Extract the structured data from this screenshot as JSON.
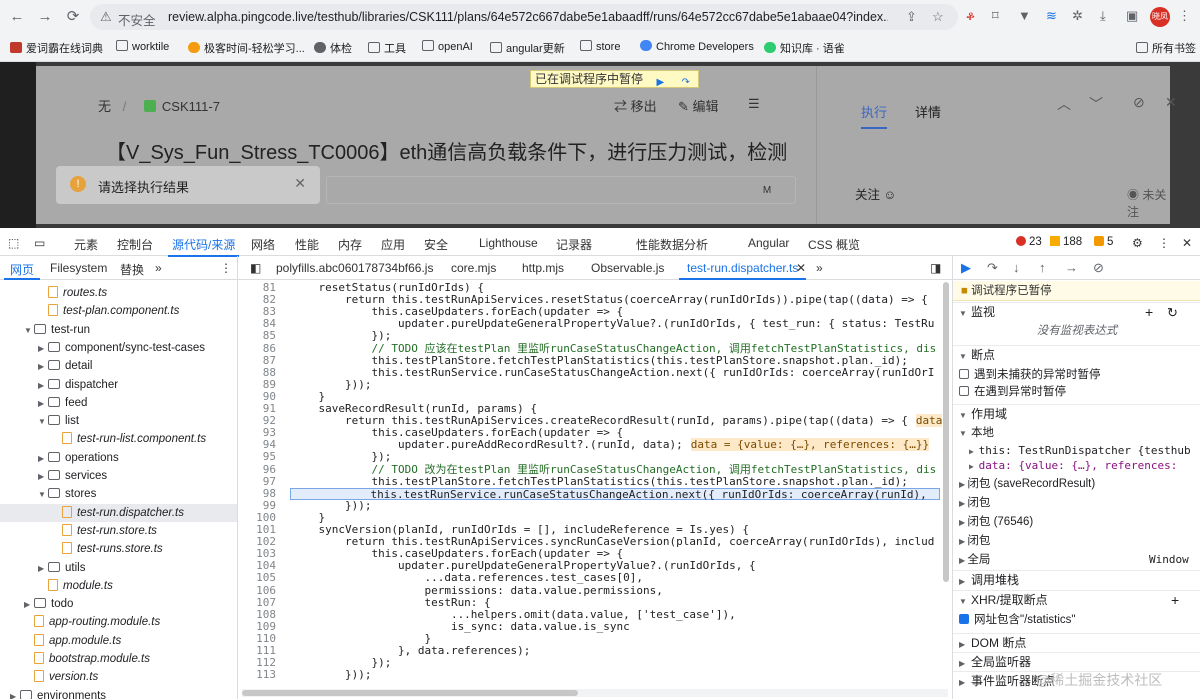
{
  "browser": {
    "not_secure": "不安全",
    "url": "review.alpha.pingcode.live/testhub/libraries/CSK111/plans/64e572c667dabe5e1abaadff/runs/64e572cc67dabe5e1abaae04?index...",
    "avatar_text": "晓凤",
    "bookmarks": [
      "爱词霸在线词典",
      "worktile",
      "极客时间-轻松学习...",
      "体检",
      "工具",
      "openAI",
      "angular更新",
      "store",
      "Chrome Developers",
      "知识库 · 语雀"
    ],
    "all_bookmarks": "所有书签"
  },
  "page": {
    "paused_banner": "已在调试程序中暂停",
    "breadcrumb_none": "无",
    "breadcrumb_sep": "/",
    "breadcrumb_case": "CSK111-7",
    "move_out": "移出",
    "edit": "编辑",
    "title": "【V_Sys_Fun_Stress_TC0006】eth通信高负载条件下，进行压力测试，检测",
    "toast": "请选择执行结果",
    "member_initial": "M",
    "tab_execute": "执行",
    "tab_detail": "详情",
    "follow": "关注",
    "not_follow": "未关注"
  },
  "devtools": {
    "tabs": [
      "元素",
      "控制台",
      "源代码/来源",
      "网络",
      "性能",
      "内存",
      "应用",
      "安全",
      "Lighthouse",
      "记录器",
      "性能数据分析",
      "Angular",
      "CSS 概览"
    ],
    "active_tab": "源代码/来源",
    "errors": "23",
    "warnings": "188",
    "issues": "5",
    "nav_tabs": [
      "网页",
      "Filesystem",
      "替换"
    ],
    "tree": [
      {
        "label": "routes.ts",
        "type": "file",
        "indent": 3,
        "italic": true
      },
      {
        "label": "test-plan.component.ts",
        "type": "file",
        "indent": 3,
        "italic": true
      },
      {
        "label": "test-run",
        "type": "folder",
        "indent": 2,
        "open": true
      },
      {
        "label": "component/sync-test-cases",
        "type": "folder",
        "indent": 3
      },
      {
        "label": "detail",
        "type": "folder",
        "indent": 3
      },
      {
        "label": "dispatcher",
        "type": "folder",
        "indent": 3
      },
      {
        "label": "feed",
        "type": "folder",
        "indent": 3
      },
      {
        "label": "list",
        "type": "folder",
        "indent": 3,
        "open": true
      },
      {
        "label": "test-run-list.component.ts",
        "type": "file",
        "indent": 4,
        "italic": true
      },
      {
        "label": "operations",
        "type": "folder",
        "indent": 3
      },
      {
        "label": "services",
        "type": "folder",
        "indent": 3
      },
      {
        "label": "stores",
        "type": "folder",
        "indent": 3,
        "open": true
      },
      {
        "label": "test-run.dispatcher.ts",
        "type": "file",
        "indent": 4,
        "italic": true,
        "selected": true
      },
      {
        "label": "test-run.store.ts",
        "type": "file",
        "indent": 4,
        "italic": true
      },
      {
        "label": "test-runs.store.ts",
        "type": "file",
        "indent": 4,
        "italic": true
      },
      {
        "label": "utils",
        "type": "folder",
        "indent": 3
      },
      {
        "label": "module.ts",
        "type": "file",
        "indent": 3,
        "italic": true
      },
      {
        "label": "todo",
        "type": "folder",
        "indent": 2
      },
      {
        "label": "app-routing.module.ts",
        "type": "file",
        "indent": 2,
        "italic": true
      },
      {
        "label": "app.module.ts",
        "type": "file",
        "indent": 2,
        "italic": true
      },
      {
        "label": "bootstrap.module.ts",
        "type": "file",
        "indent": 2,
        "italic": true
      },
      {
        "label": "version.ts",
        "type": "file",
        "indent": 2,
        "italic": true
      },
      {
        "label": "environments",
        "type": "folder",
        "indent": 1
      }
    ],
    "editor_tabs": [
      "polyfills.abc060178734bf66.js",
      "core.mjs",
      "http.mjs",
      "Observable.js",
      "test-run.dispatcher.ts"
    ],
    "active_editor_tab": "test-run.dispatcher.ts",
    "code": [
      {
        "n": "81",
        "t": "    resetStatus(runIdOrIds) {"
      },
      {
        "n": "82",
        "t": "        return this.testRunApiServices.resetStatus(coerceArray(runIdOrIds)).pipe(tap((data) => {"
      },
      {
        "n": "83",
        "t": "            this.caseUpdaters.forEach(updater => {"
      },
      {
        "n": "84",
        "t": "                updater.pureUpdateGeneralPropertyValue?.(runIdOrIds, { test_run: { status: TestRu"
      },
      {
        "n": "85",
        "t": "            });"
      },
      {
        "n": "86",
        "t": "            // TODO 应该在testPlan 里监听runCaseStatusChangeAction, 调用fetchTestPlanStatistics, dis",
        "c": "cm"
      },
      {
        "n": "87",
        "t": "            this.testPlanStore.fetchTestPlanStatistics(this.testPlanStore.snapshot.plan._id);"
      },
      {
        "n": "88",
        "t": "            this.testRunService.runCaseStatusChangeAction.next({ runIdOrIds: coerceArray(runIdOrI"
      },
      {
        "n": "89",
        "t": "        }));"
      },
      {
        "n": "90",
        "t": "    }"
      },
      {
        "n": "91",
        "t": "    saveRecordResult(runId, params) {"
      },
      {
        "n": "92",
        "t": "        return this.testRunApiServices.createRecordResult(runId, params).pipe(tap((data) => {",
        "inl": "data"
      },
      {
        "n": "93",
        "t": "            this.caseUpdaters.forEach(updater => {"
      },
      {
        "n": "94",
        "t": "                updater.pureAddRecordResult?.(runId, data);",
        "inl": "data = {value: {…}, references: {…}}"
      },
      {
        "n": "95",
        "t": "            });"
      },
      {
        "n": "96",
        "t": "            // TODO 改为在testPlan 里监听runCaseStatusChangeAction, 调用fetchTestPlanStatistics, dis",
        "c": "cm"
      },
      {
        "n": "97",
        "t": "            this.testPlanStore.fetchTestPlanStatistics(this.testPlanStore.snapshot.plan._id);"
      },
      {
        "n": "98",
        "t": "            this.testRunService.runCaseStatusChangeAction.next({ runIdOrIds: coerceArray(runId),",
        "hl": true
      },
      {
        "n": "99",
        "t": "        }));"
      },
      {
        "n": "100",
        "t": "    }"
      },
      {
        "n": "101",
        "t": "    syncVersion(planId, runIdOrIds = [], includeReference = Is.yes) {"
      },
      {
        "n": "102",
        "t": "        return this.testRunApiServices.syncRunCaseVersion(planId, coerceArray(runIdOrIds), includ"
      },
      {
        "n": "103",
        "t": "            this.caseUpdaters.forEach(updater => {"
      },
      {
        "n": "104",
        "t": "                updater.pureUpdateGeneralPropertyValue?.(runIdOrIds, {"
      },
      {
        "n": "105",
        "t": "                    ...data.references.test_cases[0],"
      },
      {
        "n": "106",
        "t": "                    permissions: data.value.permissions,"
      },
      {
        "n": "107",
        "t": "                    testRun: {"
      },
      {
        "n": "108",
        "t": "                        ...helpers.omit(data.value, ['test_case']),"
      },
      {
        "n": "109",
        "t": "                        is_sync: data.value.is_sync"
      },
      {
        "n": "110",
        "t": "                    }"
      },
      {
        "n": "111",
        "t": "                }, data.references);"
      },
      {
        "n": "112",
        "t": "            });"
      },
      {
        "n": "113",
        "t": "        }));"
      }
    ],
    "debugger": {
      "paused": "调试程序已暂停",
      "watch": "监视",
      "no_watch": "没有监视表达式",
      "breakpoints": "断点",
      "bp_uncaught": "遇到未捕获的异常时暂停",
      "bp_caught": "在遇到异常时暂停",
      "scope": "作用域",
      "local": "本地",
      "this_line": "this: TestRunDispatcher {testhub",
      "data_line": "data: {value: {…}, references:",
      "closure1": "闭包 (saveRecordResult)",
      "closure2": "闭包",
      "closure3": "闭包 (76546)",
      "closure4": "闭包",
      "global": "全局",
      "global_val": "Window",
      "call_stack": "调用堆栈",
      "xhr": "XHR/提取断点",
      "xhr_item": "网址包含\"/statistics\"",
      "dom": "DOM 断点",
      "global_listener": "全局监听器",
      "event_listener": "事件监听器断点"
    }
  },
  "watermark": "@稀土掘金技术社区"
}
